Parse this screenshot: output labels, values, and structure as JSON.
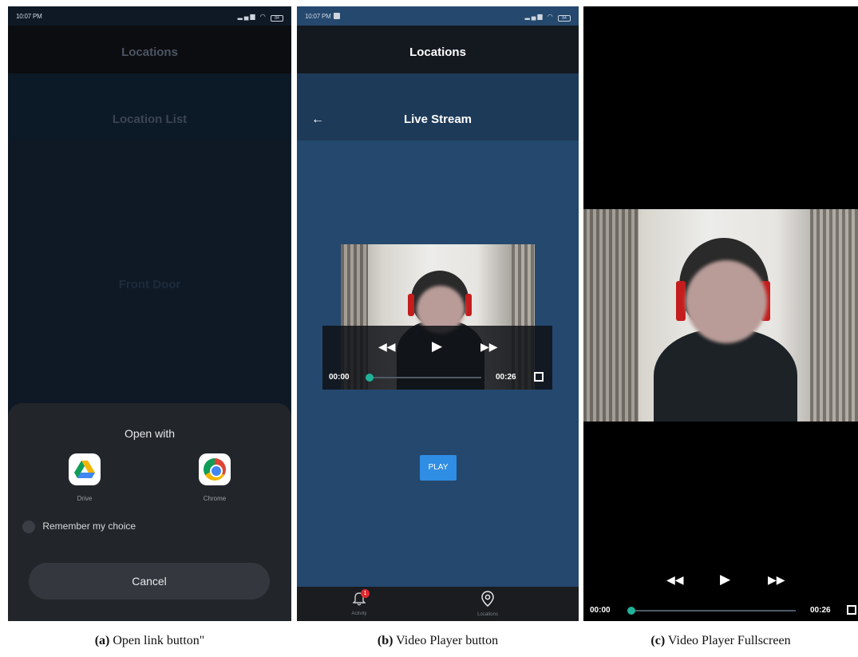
{
  "status": {
    "time": "10:07 PM",
    "battery": "84"
  },
  "panel_a": {
    "appbar_title": "Locations",
    "subbar_title": "Location List",
    "location_item": "Front Door",
    "sheet": {
      "title": "Open with",
      "apps": [
        {
          "label": "Drive"
        },
        {
          "label": "Chrome"
        }
      ],
      "remember_label": "Remember my choice",
      "cancel_label": "Cancel"
    }
  },
  "panel_b": {
    "appbar_title": "Locations",
    "subbar_title": "Live Stream",
    "player": {
      "current_time": "00:00",
      "total_time": "00:26",
      "progress": 0.0
    },
    "play_label": "PLAY",
    "nav": [
      {
        "label": "Activity",
        "badge": "1"
      },
      {
        "label": "Locations"
      }
    ]
  },
  "panel_c": {
    "player": {
      "current_time": "00:00",
      "total_time": "00:26",
      "progress": 0.0
    }
  },
  "captions": [
    {
      "letter": "(a)",
      "text": " Open link button\""
    },
    {
      "letter": "(b)",
      "text": " Video Player button"
    },
    {
      "letter": "(c)",
      "text": " Video Player Fullscreen"
    }
  ],
  "colors": {
    "accent_teal": "#1fb39a",
    "play_blue": "#2f8de4",
    "badge_red": "#e0282e"
  }
}
